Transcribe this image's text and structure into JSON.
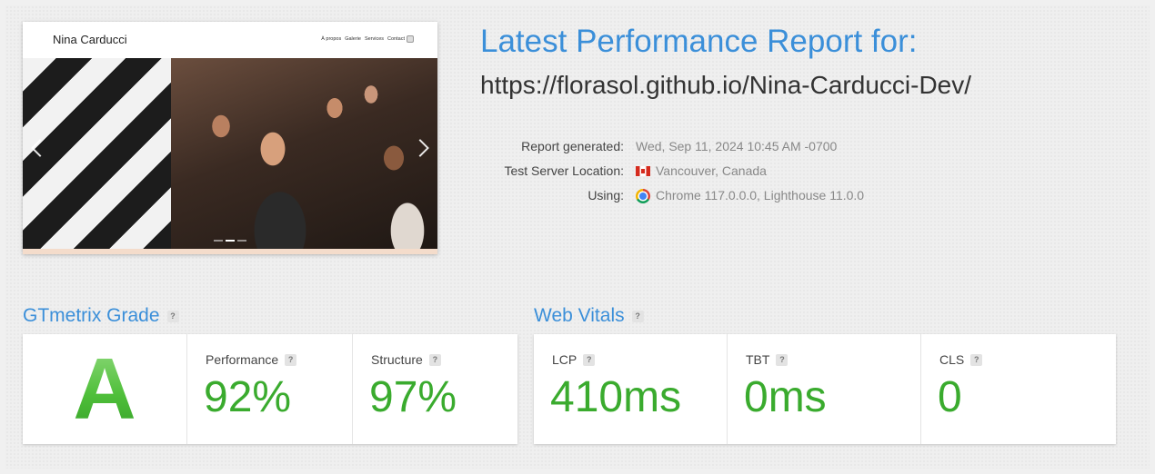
{
  "thumbnail": {
    "brand": "Nina Carducci",
    "nav": [
      "À propos",
      "Galerie",
      "Services",
      "Contact"
    ]
  },
  "report": {
    "title": "Latest Performance Report for:",
    "url": "https://florasol.github.io/Nina-Carducci-Dev/",
    "generated_label": "Report generated:",
    "generated_value": "Wed, Sep 11, 2024 10:45 AM -0700",
    "location_label": "Test Server Location:",
    "location_value": "Vancouver, Canada",
    "using_label": "Using:",
    "using_value": "Chrome 117.0.0.0, Lighthouse 11.0.0"
  },
  "grade": {
    "title": "GTmetrix Grade",
    "letter": "A",
    "performance_label": "Performance",
    "performance_value": "92%",
    "structure_label": "Structure",
    "structure_value": "97%"
  },
  "vitals": {
    "title": "Web Vitals",
    "lcp_label": "LCP",
    "lcp_value": "410ms",
    "tbt_label": "TBT",
    "tbt_value": "0ms",
    "cls_label": "CLS",
    "cls_value": "0"
  },
  "help_glyph": "?",
  "colors": {
    "accent": "#3b8fd9",
    "good": "#3aab2e"
  }
}
